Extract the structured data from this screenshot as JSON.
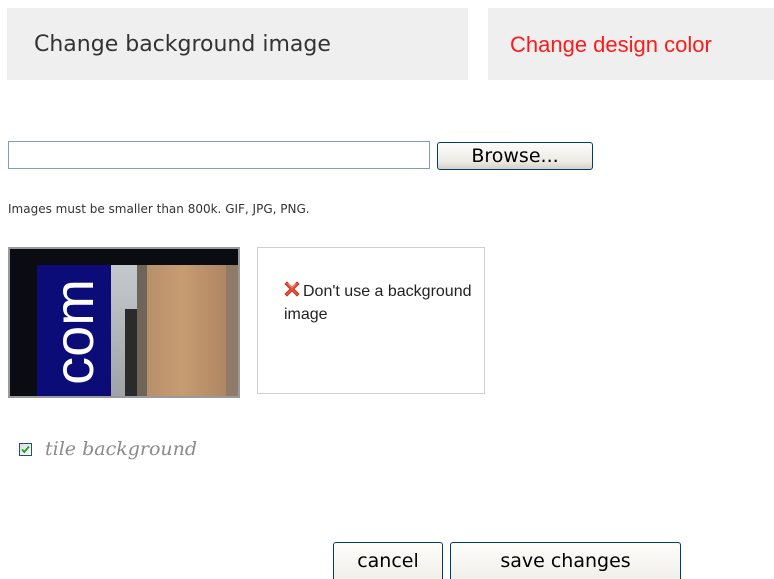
{
  "tabs": {
    "background_image": "Change background image",
    "design_color": "Change design color"
  },
  "upload": {
    "file_value": "",
    "browse_label": "Browse...",
    "hint": "Images must be smaller than 800k. GIF, JPG, PNG."
  },
  "thumbnail": {
    "overlay_text": "com"
  },
  "no_background": {
    "label": "Don't use a background image",
    "icon": "red-x-icon"
  },
  "tile": {
    "label": "tile background",
    "checked": true
  },
  "actions": {
    "cancel": "cancel",
    "save": "save changes"
  },
  "colors": {
    "tab_bg": "#efefef",
    "active_tab_text": "#ff1a1a",
    "thumb_blue": "#0b0c78"
  }
}
